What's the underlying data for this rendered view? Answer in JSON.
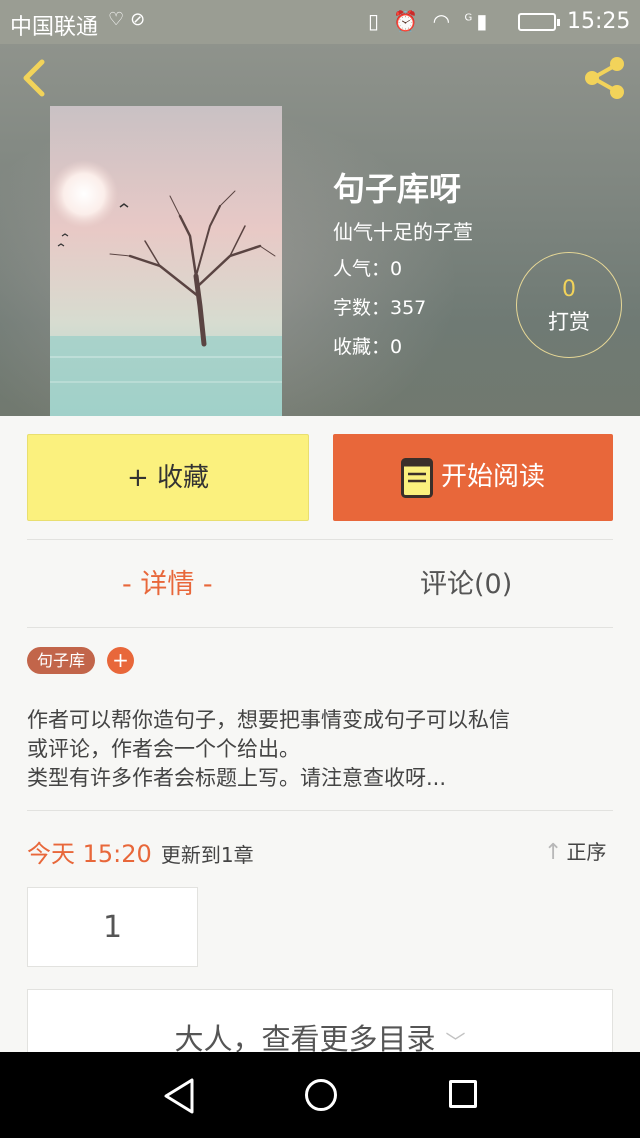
{
  "status_bar": {
    "carrier": "中国联通",
    "left_icons": [
      "shield-icon",
      "ban-icon"
    ],
    "right_icons": [
      "vibrate-icon",
      "alarm-icon",
      "wifi-icon",
      "signal-icon",
      "battery-charging-icon"
    ],
    "signal_label": "G",
    "time": "15:25"
  },
  "header": {
    "back_icon": "chevron-left-icon",
    "share_icon": "share-icon",
    "accent_color": "#f2d35a"
  },
  "book": {
    "title": "句子库呀",
    "author": "仙气十足的子萱",
    "popularity": "人气：0",
    "word_count": "字数：357",
    "favorites": "收藏：0",
    "cover_description_icon": "cover-image"
  },
  "tip": {
    "count": "0",
    "label": "打赏"
  },
  "actions": {
    "collect_label": "+ 收藏",
    "read_label": "开始阅读",
    "read_icon": "book-icon",
    "collect_color": "#fbf17e",
    "read_color": "#e8673a"
  },
  "tabs": {
    "details": "- 详情 -",
    "comments": "评论(0)"
  },
  "tags": {
    "items": [
      "句子库"
    ],
    "add_label": "+"
  },
  "description": {
    "line1": "作者可以帮你造句子，想要把事情变成句子可以私信",
    "line2": "或评论，作者会一个个给出。",
    "line3": "类型有许多作者会标题上写。请注意查收呀..."
  },
  "update": {
    "day": "今天 15:20",
    "note": "更新到1章",
    "order_label": "正序",
    "order_icon": "arrow-up-icon"
  },
  "chapters": {
    "first": "1"
  },
  "catalog": {
    "more_label": "大人，查看更多目录",
    "chevron": "﹀"
  },
  "nav": {
    "icons": [
      "back-triangle-icon",
      "home-circle-icon",
      "recent-square-icon"
    ]
  }
}
